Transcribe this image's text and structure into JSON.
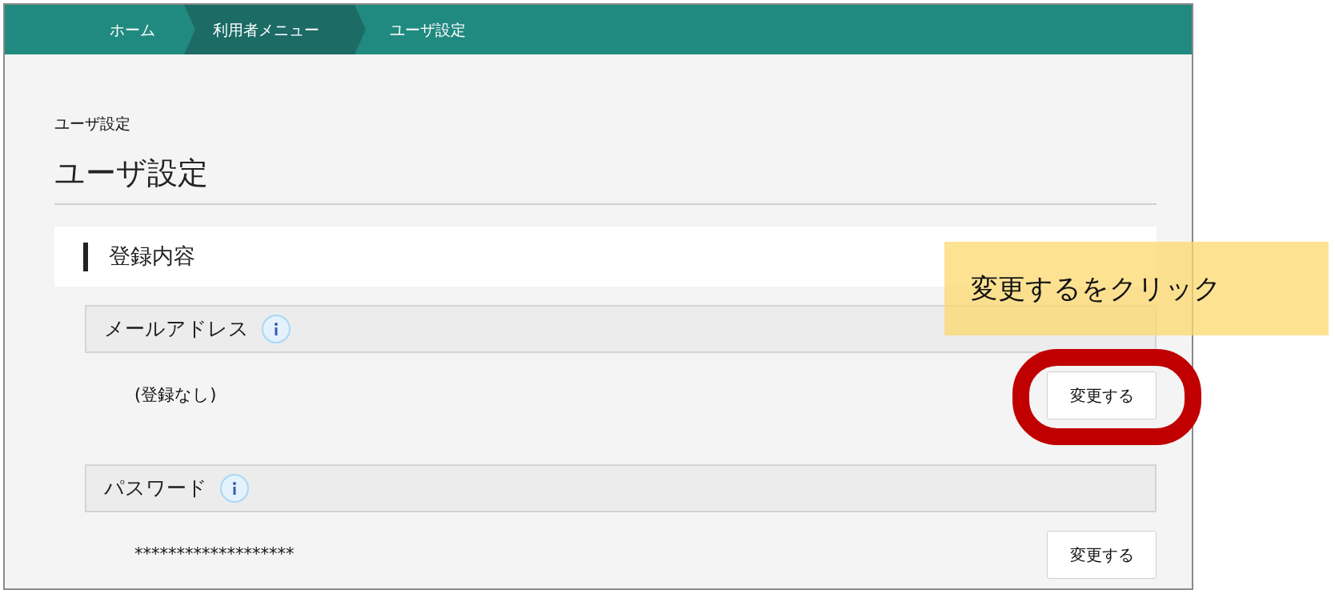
{
  "breadcrumbs": [
    {
      "label": "ホーム",
      "selected": false
    },
    {
      "label": "利用者メニュー",
      "selected": true
    },
    {
      "label": "ユーザ設定",
      "selected": false
    }
  ],
  "page_label": "ユーザ設定",
  "page_title": "ユーザ設定",
  "section_title": "登録内容",
  "fields": [
    {
      "label": "メールアドレス",
      "value": "(登録なし)",
      "button": "変更する",
      "highlighted": true
    },
    {
      "label": "パスワード",
      "value": "*******************",
      "button": "変更する",
      "highlighted": false
    }
  ],
  "callout": "変更するをクリック"
}
